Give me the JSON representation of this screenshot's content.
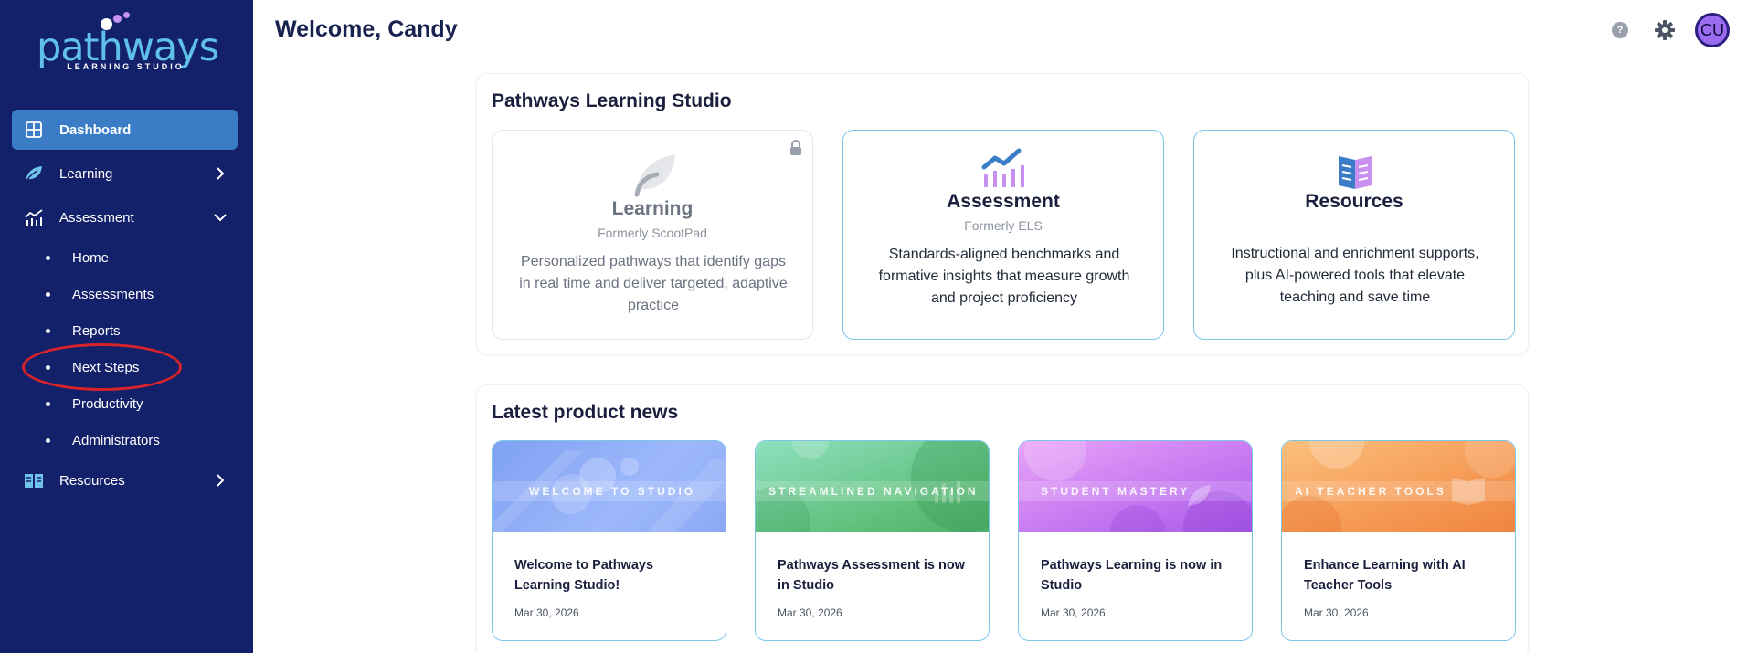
{
  "sidebar": {
    "logo": {
      "word": "pathways",
      "subtitle": "LEARNING STUDIO"
    },
    "nav": {
      "dashboard": "Dashboard",
      "learning": "Learning",
      "assessment": "Assessment",
      "resources": "Resources"
    },
    "assessment_sub": [
      "Home",
      "Assessments",
      "Reports",
      "Next Steps",
      "Productivity",
      "Administrators"
    ]
  },
  "header": {
    "welcome": "Welcome, Candy",
    "help_glyph": "?",
    "avatar_initials": "CU"
  },
  "studio": {
    "title": "Pathways Learning Studio",
    "cards": [
      {
        "name": "Learning",
        "formerly": "Formerly ScootPad",
        "description": "Personalized pathways that identify gaps in real time and deliver targeted, adaptive practice",
        "locked": true,
        "icon": "leaf-icon"
      },
      {
        "name": "Assessment",
        "formerly": "Formerly ELS",
        "description": "Standards-aligned benchmarks and formative insights that measure growth and project proficiency",
        "locked": false,
        "icon": "chart-icon"
      },
      {
        "name": "Resources",
        "formerly": "",
        "description": "Instructional and enrichment supports, plus AI-powered tools that elevate teaching and save time",
        "locked": false,
        "icon": "book-icon"
      }
    ]
  },
  "news": {
    "title": "Latest product news",
    "items": [
      {
        "tag": "WELCOME TO STUDIO",
        "title": "Welcome to Pathways Learning Studio!",
        "date": "Mar 30, 2026"
      },
      {
        "tag": "STREAMLINED NAVIGATION",
        "title": "Pathways Assessment is now in Studio",
        "date": "Mar 30, 2026"
      },
      {
        "tag": "STUDENT MASTERY",
        "title": "Pathways Learning is now in Studio",
        "date": "Mar 30, 2026"
      },
      {
        "tag": "AI TEACHER TOOLS",
        "title": "Enhance Learning with AI Teacher Tools",
        "date": "Mar 30, 2026"
      }
    ]
  },
  "colors": {
    "sidebar_bg": "#13206a",
    "active_nav": "#3a7cc6",
    "accent_border": "#7cc6e8",
    "highlight_ring": "#d9232b"
  }
}
